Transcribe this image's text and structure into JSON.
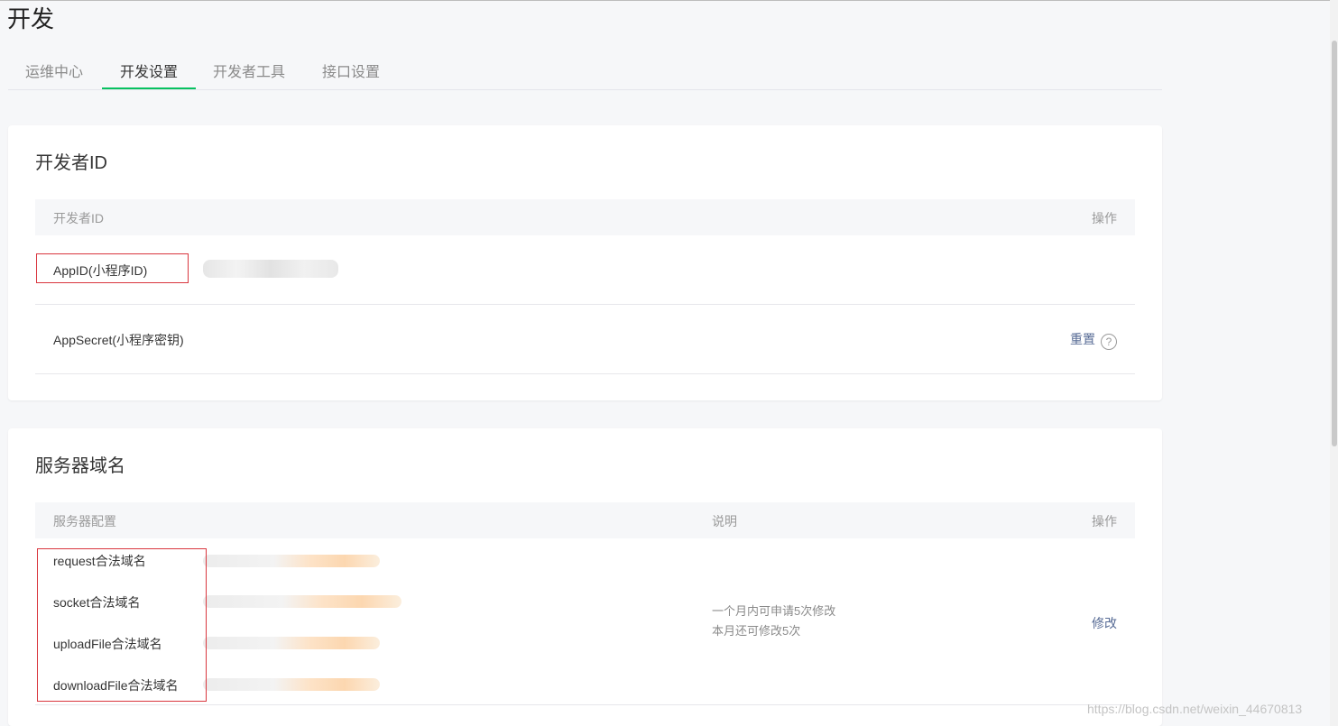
{
  "page": {
    "title": "开发"
  },
  "tabs": [
    "运维中心",
    "开发设置",
    "开发者工具",
    "接口设置"
  ],
  "developer_id": {
    "title": "开发者ID",
    "header": {
      "col1": "开发者ID",
      "col2": "操作"
    },
    "appid_label": "AppID(小程序ID)",
    "appsecret_label": "AppSecret(小程序密钥)",
    "reset_label": "重置",
    "help_icon": "?"
  },
  "server_domain": {
    "title": "服务器域名",
    "header": {
      "col1": "服务器配置",
      "col2": "说明",
      "col3": "操作"
    },
    "rows": [
      "request合法域名",
      "socket合法域名",
      "uploadFile合法域名",
      "downloadFile合法域名"
    ],
    "desc_line1": "一个月内可申请5次修改",
    "desc_line2": "本月还可修改5次",
    "modify_label": "修改"
  },
  "watermark": "https://blog.csdn.net/weixin_44670813",
  "colors": {
    "accent": "#07c160",
    "link": "#576b95",
    "highlight": "#d9363e"
  }
}
